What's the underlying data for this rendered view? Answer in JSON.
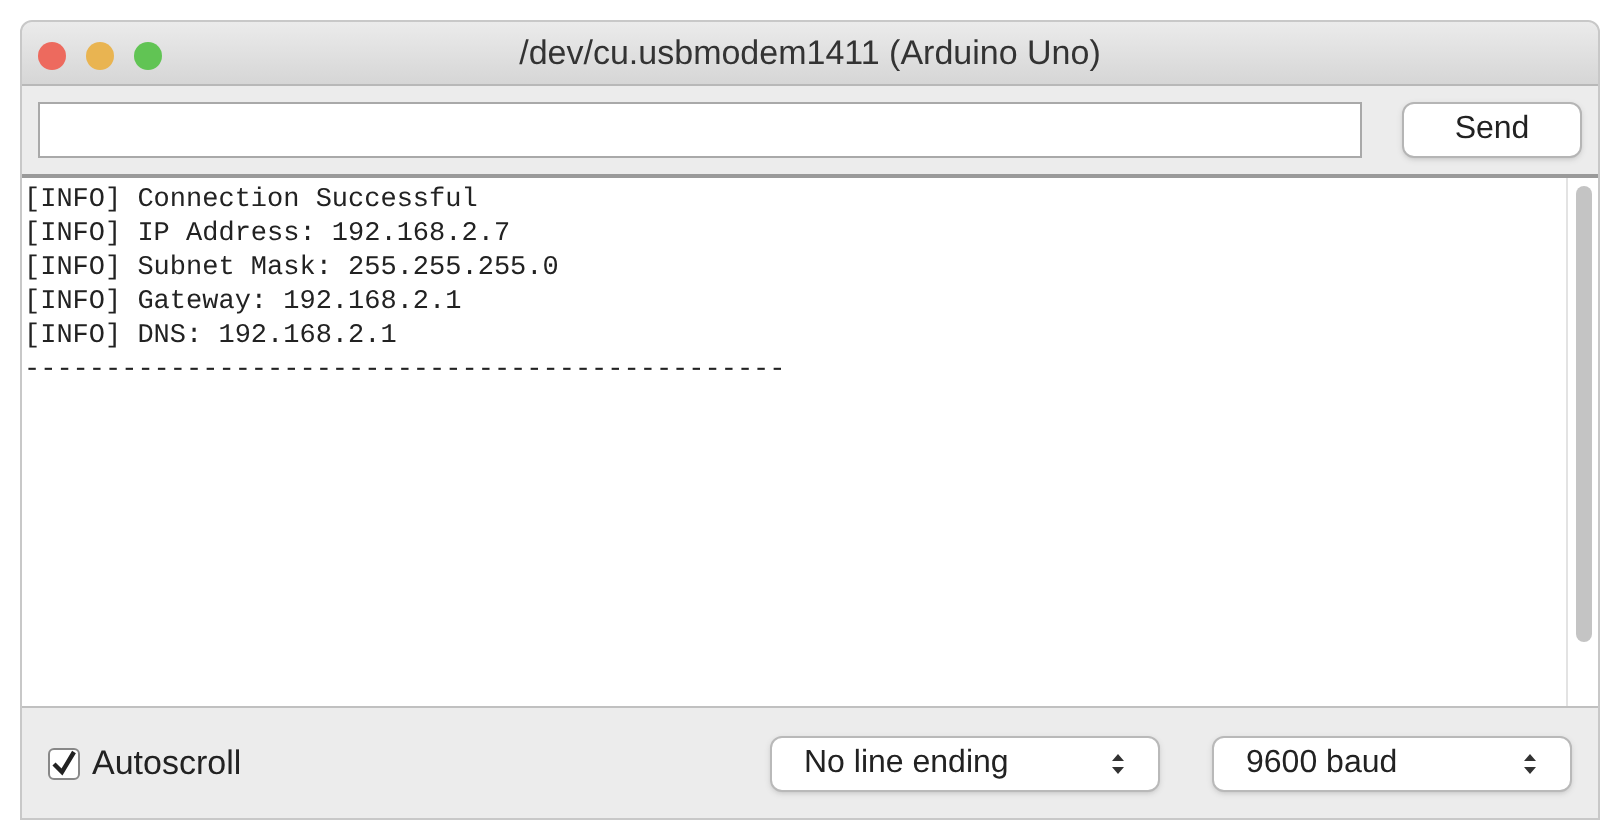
{
  "window": {
    "title": "/dev/cu.usbmodem1411 (Arduino Uno)"
  },
  "send_button": "Send",
  "console_lines": [
    "[INFO] Connection Successful",
    "[INFO] IP Address: 192.168.2.7",
    "[INFO] Subnet Mask: 255.255.255.0",
    "[INFO] Gateway: 192.168.2.1",
    "[INFO] DNS: 192.168.2.1",
    "-----------------------------------------------"
  ],
  "autoscroll": {
    "label": "Autoscroll",
    "checked": true
  },
  "line_ending": {
    "value": "No line ending"
  },
  "baud": {
    "value": "9600 baud"
  }
}
